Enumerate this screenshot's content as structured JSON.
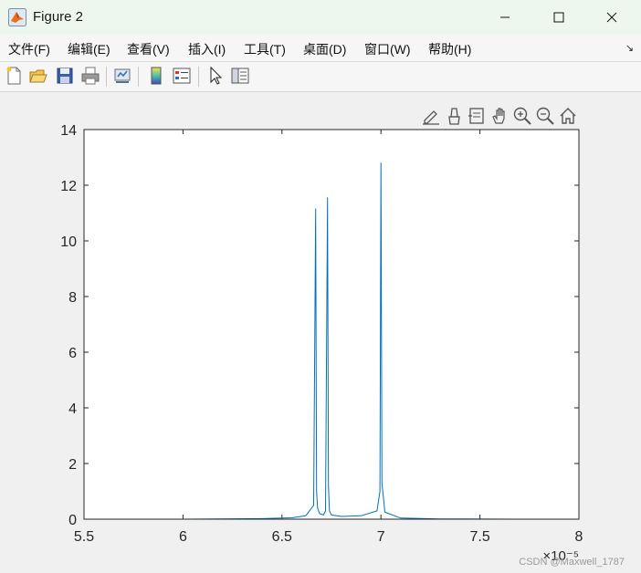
{
  "window": {
    "title": "Figure 2",
    "minimize_icon": "minimize-icon",
    "maximize_icon": "maximize-icon",
    "close_icon": "close-icon"
  },
  "menu": {
    "items": [
      "文件(F)",
      "编辑(E)",
      "查看(V)",
      "插入(I)",
      "工具(T)",
      "桌面(D)",
      "窗口(W)",
      "帮助(H)"
    ],
    "overflow": "↘"
  },
  "toolbar": {
    "icons": [
      "new-figure-icon",
      "open-file-icon",
      "save-icon",
      "print-icon",
      "link-plot-icon",
      "colorbar-icon",
      "legend-icon",
      "pointer-icon",
      "property-inspector-icon"
    ]
  },
  "axes_toolbar": {
    "icons": [
      "brush-edit-icon",
      "data-tips-icon",
      "export-icon",
      "pan-icon",
      "zoom-in-icon",
      "zoom-out-icon",
      "home-icon"
    ]
  },
  "chart_data": {
    "type": "line",
    "title": "",
    "xlabel": "",
    "ylabel": "",
    "x_exponent_label": "×10⁻⁵",
    "xlim": [
      5.5e-05,
      8e-05
    ],
    "ylim": [
      0,
      14
    ],
    "xticks": [
      5.5,
      6,
      6.5,
      7,
      7.5,
      8
    ],
    "xtick_labels": [
      "5.5",
      "6",
      "6.5",
      "7",
      "7.5",
      "8"
    ],
    "yticks": [
      0,
      2,
      4,
      6,
      8,
      10,
      12,
      14
    ],
    "ytick_labels": [
      "0",
      "2",
      "4",
      "6",
      "8",
      "10",
      "12",
      "14"
    ],
    "grid": false,
    "color": "#0072bd",
    "series": [
      {
        "x": [
          5.66e-05,
          6e-05,
          6.4e-05,
          6.55e-05,
          6.62e-05,
          6.66e-05,
          6.67e-05,
          6.675e-05,
          6.68e-05,
          6.69e-05,
          6.71e-05,
          6.72e-05,
          6.73e-05,
          6.735e-05,
          6.74e-05,
          6.75e-05,
          6.8e-05,
          6.9e-05,
          6.98e-05,
          6.995e-05,
          7e-05,
          7.005e-05,
          7.02e-05,
          7.1e-05,
          7.3e-05,
          7.68e-05
        ],
        "y": [
          0,
          0,
          0.02,
          0.05,
          0.12,
          0.5,
          11.15,
          1.0,
          0.4,
          0.2,
          0.15,
          0.3,
          11.55,
          1.2,
          0.3,
          0.15,
          0.1,
          0.12,
          0.3,
          1.0,
          12.8,
          1.3,
          0.25,
          0.04,
          0.01,
          0
        ]
      }
    ]
  },
  "watermark": "CSDN @Maxwell_1787"
}
